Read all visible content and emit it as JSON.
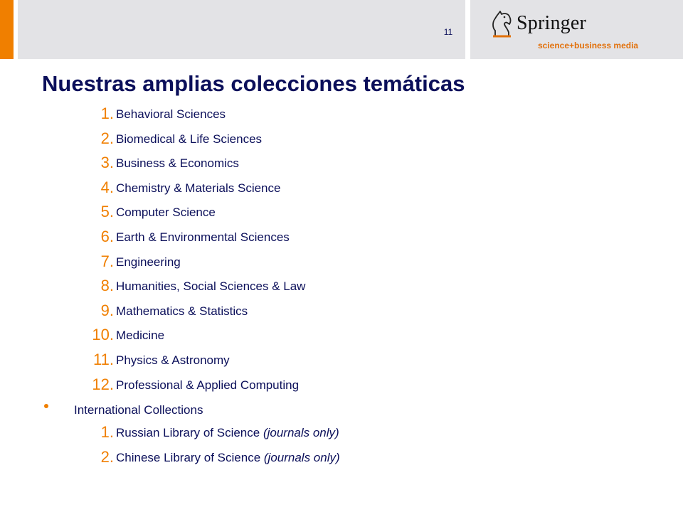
{
  "slide": {
    "page_number": "11",
    "title": "Nuestras amplias colecciones temáticas"
  },
  "logo": {
    "name": "Springer",
    "tagline": "science+business media",
    "icon": "knight-horse-icon"
  },
  "colors": {
    "accent_orange": "#f07f00",
    "header_gray": "#e3e3e6",
    "text_navy": "#0b0f5a"
  },
  "subject_collections": [
    {
      "number": "1.",
      "label": "Behavioral Sciences"
    },
    {
      "number": "2.",
      "label": "Biomedical & Life Sciences"
    },
    {
      "number": "3.",
      "label": "Business & Economics"
    },
    {
      "number": "4.",
      "label": "Chemistry & Materials Science"
    },
    {
      "number": "5.",
      "label": "Computer Science"
    },
    {
      "number": "6.",
      "label": "Earth & Environmental Sciences"
    },
    {
      "number": "7.",
      "label": "Engineering"
    },
    {
      "number": "8.",
      "label": "Humanities, Social Sciences & Law"
    },
    {
      "number": "9.",
      "label": "Mathematics & Statistics"
    },
    {
      "number": "10.",
      "label": "Medicine"
    },
    {
      "number": "11.",
      "label": "Physics & Astronomy"
    },
    {
      "number": "12.",
      "label": "Professional  & Applied Computing"
    }
  ],
  "international": {
    "label": "International Collections",
    "items": [
      {
        "number": "1.",
        "label": "Russian Library of Science ",
        "note": "(journals only)"
      },
      {
        "number": "2.",
        "label": "Chinese Library of Science ",
        "note": "(journals only)"
      }
    ]
  }
}
